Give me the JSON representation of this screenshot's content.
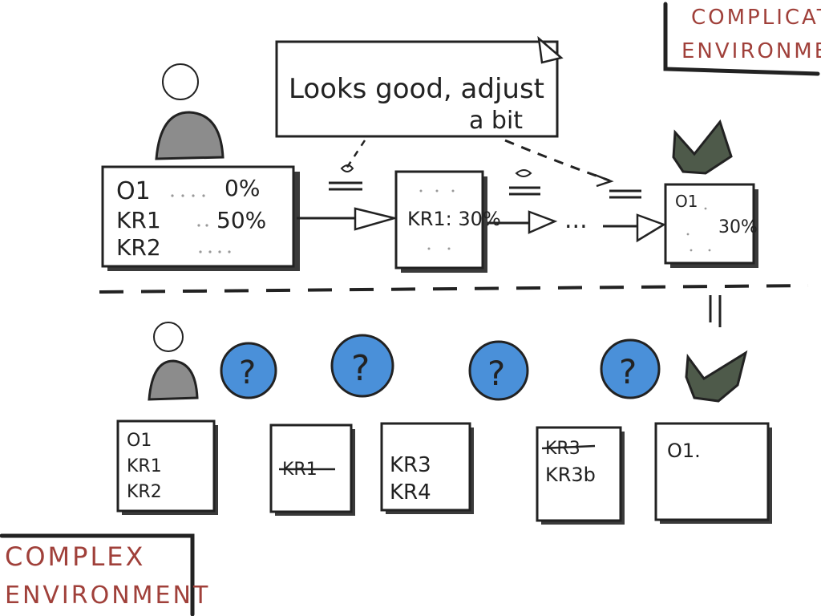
{
  "labels": {
    "complicated_line1": "COMPLICATED",
    "complicated_line2": "ENVIRONMENT",
    "complex_line1": "COMPLEX",
    "complex_line2": "ENVIRONMENT"
  },
  "speech_bubble": {
    "line1": "Looks good, adjust",
    "line2": "a bit"
  },
  "top_flow": {
    "card1": {
      "rows": [
        {
          "name": "O1",
          "value": "0%"
        },
        {
          "name": "KR1",
          "value": "50%"
        },
        {
          "name": "KR2",
          "value": ""
        }
      ]
    },
    "card2": {
      "text": "KR1: 30%"
    },
    "ellipsis": "...",
    "card3": {
      "line1": "O1",
      "line2": "30%"
    }
  },
  "bottom_row": {
    "question_mark": "?",
    "card1": {
      "lines": [
        "O1",
        "KR1",
        "KR2"
      ]
    },
    "card2": {
      "struck": "KR1"
    },
    "card3": {
      "lines": [
        "KR3",
        "KR4"
      ]
    },
    "card4": {
      "struck": "KR3",
      "line2": "KR3b"
    },
    "card5": {
      "line1": "O1."
    }
  },
  "colors": {
    "accent_blue": "#4a90d9",
    "label_red": "#a0403a",
    "person_gray": "#8c8c8c",
    "check_green": "#4e5a4a"
  }
}
